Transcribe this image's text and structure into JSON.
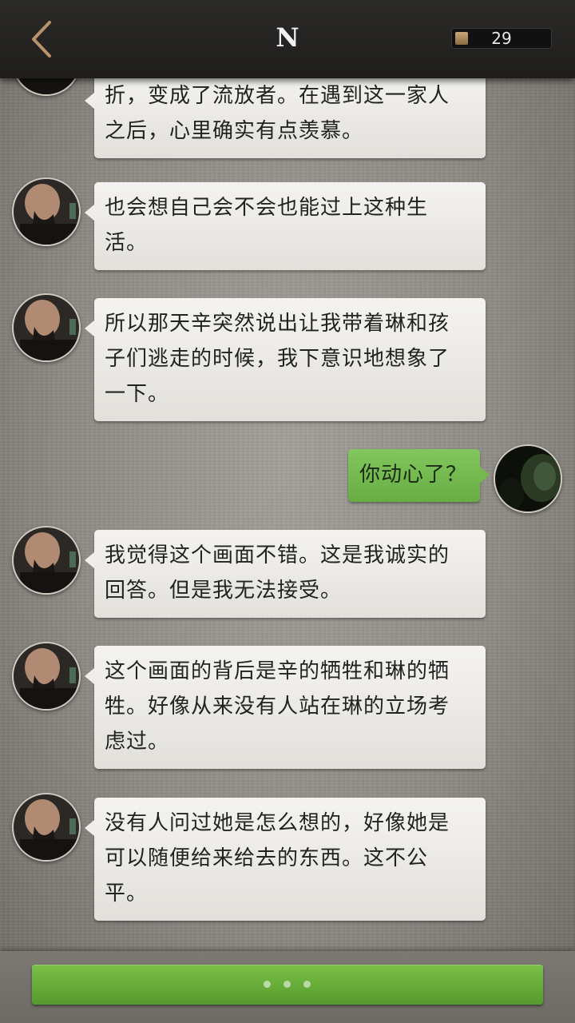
{
  "header": {
    "title": "N",
    "coins": "29"
  },
  "messages": [
    {
      "from": "other",
      "lines": [
        "折，变成了流放者。在遇到这一家人",
        "之后，心里确实有点羡慕。"
      ]
    },
    {
      "from": "other",
      "lines": [
        "也会想自己会不会也能过上这种生",
        "活。"
      ]
    },
    {
      "from": "other",
      "lines": [
        "所以那天辛突然说出让我带着琳和孩",
        "子们逃走的时候，我下意识地想象了",
        "一下。"
      ]
    },
    {
      "from": "me",
      "lines": [
        "你动心了？"
      ]
    },
    {
      "from": "other",
      "lines": [
        "我觉得这个画面不错。这是我诚实的",
        "回答。但是我无法接受。"
      ]
    },
    {
      "from": "other",
      "lines": [
        "这个画面的背后是辛的牺牲和琳的牺",
        "牲。好像从来没有人站在琳的立场考",
        "虑过。"
      ]
    },
    {
      "from": "other",
      "lines": [
        "没有人问过她是怎么想的，好像她是",
        "可以随便给来给去的东西。这不公",
        "平。"
      ]
    }
  ],
  "colors": {
    "accent_green": "#6cb342",
    "back_arrow": "#b8926a",
    "header_bg": "#252422"
  },
  "icons": {
    "back": "chevron-left-icon",
    "coin": "coin-icon",
    "loading": "typing-dots-icon"
  }
}
